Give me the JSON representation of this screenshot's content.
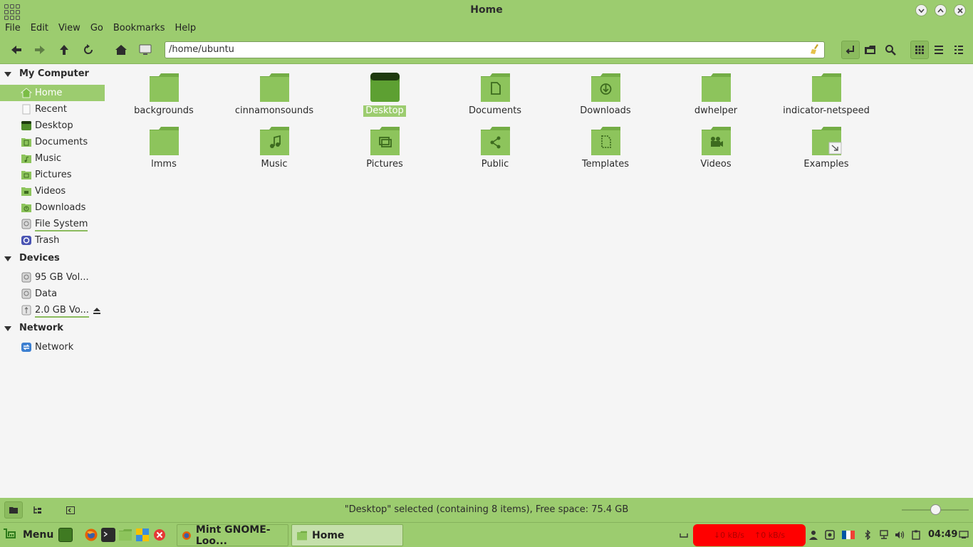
{
  "window": {
    "title": "Home"
  },
  "menubar": {
    "items": [
      "File",
      "Edit",
      "View",
      "Go",
      "Bookmarks",
      "Help"
    ]
  },
  "toolbar": {
    "location": "/home/ubuntu"
  },
  "sidebar": {
    "sections": [
      {
        "title": "My Computer",
        "items": [
          {
            "label": "Home",
            "icon": "home-icon",
            "selected": true
          },
          {
            "label": "Recent",
            "icon": "recent-icon"
          },
          {
            "label": "Desktop",
            "icon": "desktop-icon"
          },
          {
            "label": "Documents",
            "icon": "documents-folder-icon"
          },
          {
            "label": "Music",
            "icon": "music-folder-icon"
          },
          {
            "label": "Pictures",
            "icon": "pictures-folder-icon"
          },
          {
            "label": "Videos",
            "icon": "videos-folder-icon"
          },
          {
            "label": "Downloads",
            "icon": "downloads-folder-icon"
          },
          {
            "label": "File System",
            "icon": "drive-icon"
          },
          {
            "label": "Trash",
            "icon": "trash-icon"
          }
        ]
      },
      {
        "title": "Devices",
        "items": [
          {
            "label": "95 GB Vol...",
            "icon": "drive-icon"
          },
          {
            "label": "Data",
            "icon": "drive-icon"
          },
          {
            "label": "2.0 GB Vo...",
            "icon": "usb-icon"
          }
        ]
      },
      {
        "title": "Network",
        "items": [
          {
            "label": "Network",
            "icon": "network-icon"
          }
        ]
      }
    ]
  },
  "files": [
    {
      "name": "backgrounds",
      "type": "folder"
    },
    {
      "name": "cinnamonsounds",
      "type": "folder"
    },
    {
      "name": "Desktop",
      "type": "desktop",
      "selected": true
    },
    {
      "name": "Documents",
      "type": "documents"
    },
    {
      "name": "Downloads",
      "type": "downloads"
    },
    {
      "name": "dwhelper",
      "type": "folder"
    },
    {
      "name": "indicator-netspeed",
      "type": "folder"
    },
    {
      "name": "lmms",
      "type": "folder"
    },
    {
      "name": "Music",
      "type": "music"
    },
    {
      "name": "Pictures",
      "type": "pictures"
    },
    {
      "name": "Public",
      "type": "public"
    },
    {
      "name": "Templates",
      "type": "templates"
    },
    {
      "name": "Videos",
      "type": "videos"
    },
    {
      "name": "Examples",
      "type": "link"
    }
  ],
  "statusbar": {
    "text": "\"Desktop\" selected (containing 8 items), Free space: 75.4 GB"
  },
  "taskbar": {
    "menu_label": "Menu",
    "tasks": [
      {
        "label": "Mint GNOME-Loo..."
      },
      {
        "label": "Home",
        "active": true
      }
    ],
    "netspeed": {
      "down": "↓0 kB/s",
      "up": "↑0 kB/s"
    },
    "clock": "04:49"
  },
  "colors": {
    "accent": "#9ccc6f",
    "folder": "#8dc45c",
    "folder_dark": "#74ad45",
    "netspeed_bg": "#ff0000"
  }
}
